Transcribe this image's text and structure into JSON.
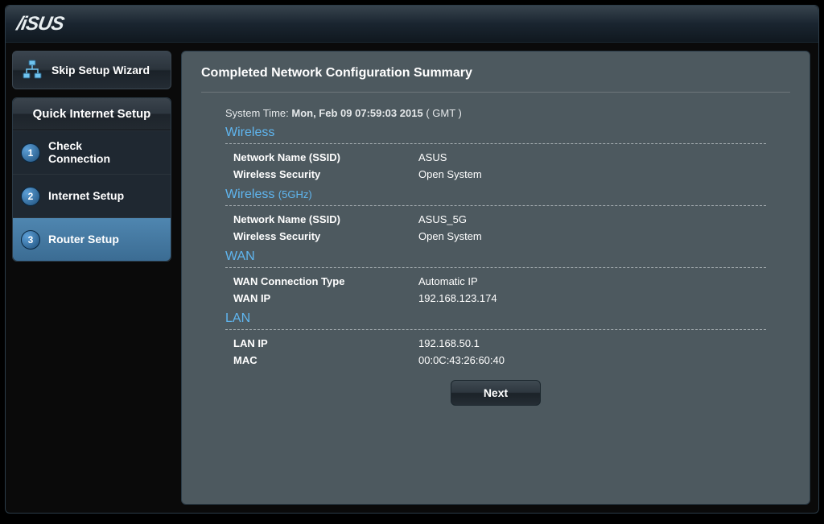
{
  "brand": "/iSUS",
  "skip_button": "Skip Setup Wizard",
  "sidebar": {
    "title": "Quick Internet Setup",
    "steps": [
      {
        "num": "1",
        "label": "Check\nConnection"
      },
      {
        "num": "2",
        "label": "Internet Setup"
      },
      {
        "num": "3",
        "label": "Router Setup"
      }
    ],
    "active_index": 2
  },
  "page_title": "Completed Network Configuration Summary",
  "system_time": {
    "label": "System Time:",
    "value": "Mon, Feb 09 07:59:03 2015",
    "tz": "( GMT )"
  },
  "sections": {
    "wireless": {
      "title": "Wireless",
      "rows": [
        {
          "key": "Network Name (SSID)",
          "val": "ASUS"
        },
        {
          "key": "Wireless Security",
          "val": "Open System"
        }
      ]
    },
    "wireless5": {
      "title": "Wireless",
      "sub": "(5GHz)",
      "rows": [
        {
          "key": "Network Name (SSID)",
          "val": "ASUS_5G"
        },
        {
          "key": "Wireless Security",
          "val": "Open System"
        }
      ]
    },
    "wan": {
      "title": "WAN",
      "rows": [
        {
          "key": "WAN Connection Type",
          "val": "Automatic IP"
        },
        {
          "key": "WAN IP",
          "val": "192.168.123.174"
        }
      ]
    },
    "lan": {
      "title": "LAN",
      "rows": [
        {
          "key": "LAN IP",
          "val": "192.168.50.1"
        },
        {
          "key": "MAC",
          "val": "00:0C:43:26:60:40"
        }
      ]
    }
  },
  "next_button": "Next"
}
